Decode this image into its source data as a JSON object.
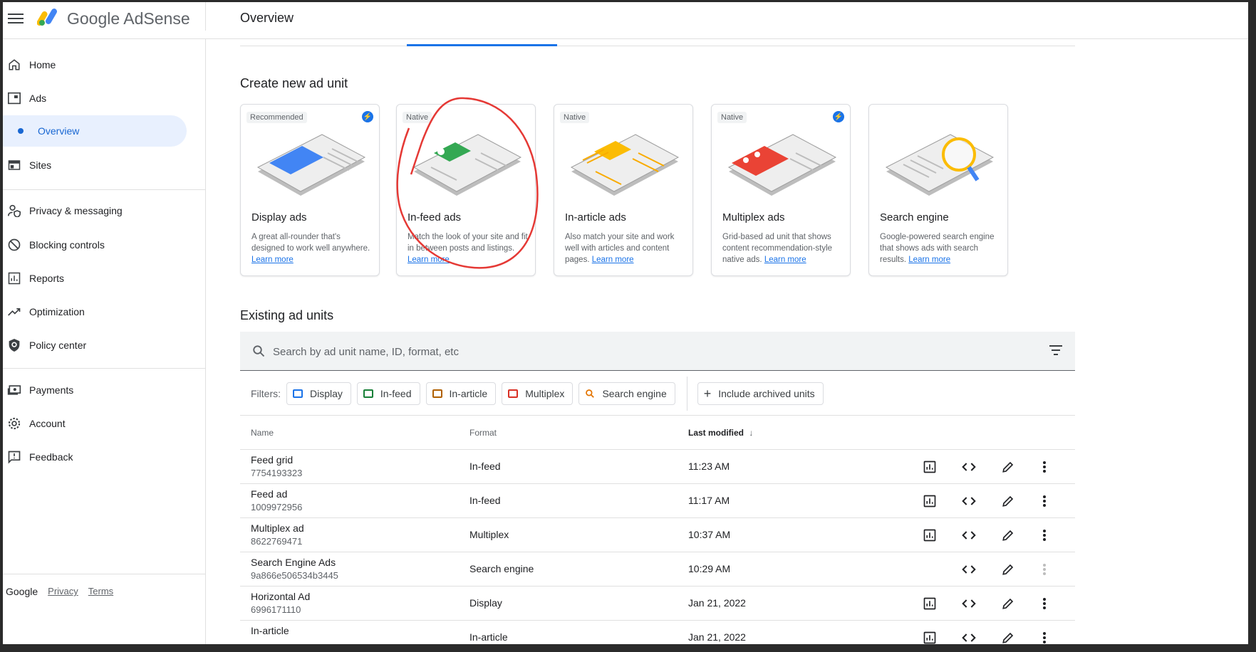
{
  "header": {
    "brand_google": "Google",
    "brand_product": "AdSense",
    "page_title": "Overview"
  },
  "sidebar": {
    "items": [
      {
        "label": "Home",
        "icon": "home-icon"
      },
      {
        "label": "Ads",
        "icon": "ads-icon"
      },
      {
        "label": "Overview",
        "icon": "dot"
      },
      {
        "label": "Sites",
        "icon": "sites-icon"
      },
      {
        "label": "Privacy & messaging",
        "icon": "person-shield-icon"
      },
      {
        "label": "Blocking controls",
        "icon": "block-icon"
      },
      {
        "label": "Reports",
        "icon": "reports-icon"
      },
      {
        "label": "Optimization",
        "icon": "trending-icon"
      },
      {
        "label": "Policy center",
        "icon": "policy-icon"
      },
      {
        "label": "Payments",
        "icon": "payments-icon"
      },
      {
        "label": "Account",
        "icon": "gear-icon"
      },
      {
        "label": "Feedback",
        "icon": "feedback-icon"
      }
    ],
    "footer": {
      "google": "Google",
      "privacy": "Privacy",
      "terms": "Terms"
    }
  },
  "create_section": {
    "title": "Create new ad unit",
    "cards": [
      {
        "badge": "Recommended",
        "title": "Display ads",
        "desc": "A great all-rounder that's designed to work well anywhere.",
        "link": "Learn more",
        "color": "#4285f4"
      },
      {
        "badge": "Native",
        "title": "In-feed ads",
        "desc": "Match the look of your site and fit in between posts and listings.",
        "link": "Learn more",
        "color": "#34a853"
      },
      {
        "badge": "Native",
        "title": "In-article ads",
        "desc": "Also match your site and work well with articles and content pages.",
        "link": "Learn more",
        "color": "#fbbc04"
      },
      {
        "badge": "Native",
        "title": "Multiplex ads",
        "desc": "Grid-based ad unit that shows content recommendation-style native ads.",
        "link": "Learn more",
        "color": "#ea4335"
      },
      {
        "badge": "",
        "title": "Search engine",
        "desc": "Google-powered search engine that shows ads with search results.",
        "link": "Learn more",
        "color": "#fbbc04"
      }
    ]
  },
  "existing_section": {
    "title": "Existing ad units",
    "search_placeholder": "Search by ad unit name, ID, format, etc",
    "filters_label": "Filters:",
    "filters": [
      {
        "label": "Display",
        "color": "#1a73e8"
      },
      {
        "label": "In-feed",
        "color": "#188038"
      },
      {
        "label": "In-article",
        "color": "#b06000"
      },
      {
        "label": "Multiplex",
        "color": "#d93025"
      },
      {
        "label": "Search engine",
        "color": "#e37400"
      }
    ],
    "include_archived": "Include archived units",
    "columns": {
      "name": "Name",
      "format": "Format",
      "last_modified": "Last modified"
    },
    "rows": [
      {
        "name": "Feed grid",
        "id": "7754193323",
        "format": "In-feed",
        "modified": "11:23 AM"
      },
      {
        "name": "Feed ad",
        "id": "1009972956",
        "format": "In-feed",
        "modified": "11:17 AM"
      },
      {
        "name": "Multiplex ad",
        "id": "8622769471",
        "format": "Multiplex",
        "modified": "10:37 AM"
      },
      {
        "name": "Search Engine Ads",
        "id": "9a866e506534b3445",
        "format": "Search engine",
        "modified": "10:29 AM"
      },
      {
        "name": "Horizontal Ad",
        "id": "6996171110",
        "format": "Display",
        "modified": "Jan 21, 2022"
      },
      {
        "name": "In-article",
        "id": "",
        "format": "In-article",
        "modified": "Jan 21, 2022"
      }
    ]
  }
}
